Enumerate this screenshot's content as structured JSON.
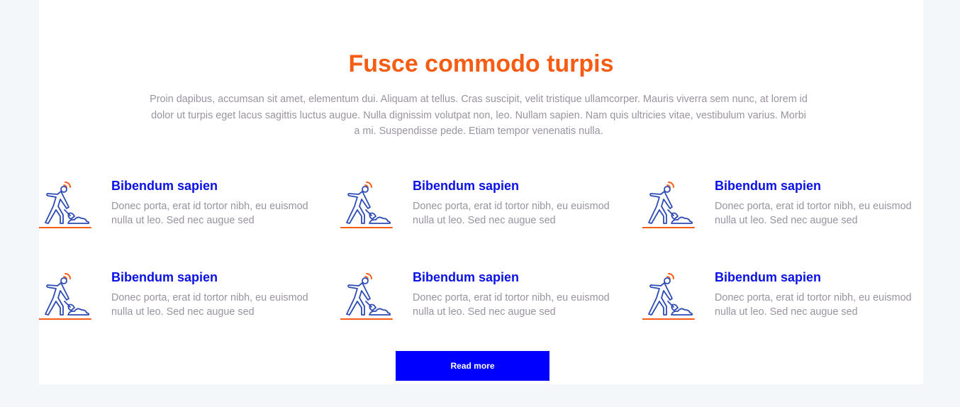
{
  "section": {
    "title": "Fusce commodo turpis",
    "intro": "Proin dapibus, accumsan sit amet, elementum dui. Aliquam at tellus. Cras suscipit, velit tristique ullamcorper. Mauris viverra sem nunc, at lorem id dolor ut turpis eget lacus sagittis luctus augue. Nulla dignissim volutpat non, leo. Nullam sapien. Nam quis ultricies vitae, vestibulum varius. Morbi a mi. Suspendisse pede. Etiam tempor venenatis nulla."
  },
  "features": [
    {
      "icon": "worker-shoveling-icon",
      "title": "Bibendum sapien",
      "text": "Donec porta, erat id tortor nibh, eu euismod nulla ut leo. Sed nec augue sed"
    },
    {
      "icon": "worker-shoveling-icon",
      "title": "Bibendum sapien",
      "text": "Donec porta, erat id tortor nibh, eu euismod nulla ut leo. Sed nec augue sed"
    },
    {
      "icon": "worker-shoveling-icon",
      "title": "Bibendum sapien",
      "text": "Donec porta, erat id tortor nibh, eu euismod nulla ut leo. Sed nec augue sed"
    },
    {
      "icon": "worker-shoveling-icon",
      "title": "Bibendum sapien",
      "text": "Donec porta, erat id tortor nibh, eu euismod nulla ut leo. Sed nec augue sed"
    },
    {
      "icon": "worker-shoveling-icon",
      "title": "Bibendum sapien",
      "text": "Donec porta, erat id tortor nibh, eu euismod nulla ut leo. Sed nec augue sed"
    },
    {
      "icon": "worker-shoveling-icon",
      "title": "Bibendum sapien",
      "text": "Donec porta, erat id tortor nibh, eu euismod nulla ut leo. Sed nec augue sed"
    }
  ],
  "read_more_label": "Read more",
  "colors": {
    "accent_orange": "#f75c14",
    "heading_blue": "#0a10e8",
    "button_blue": "#0000ff",
    "body_text": "#9a939f",
    "icon_stroke": "#2d4bb4",
    "page_background": "#f4f7fa"
  }
}
